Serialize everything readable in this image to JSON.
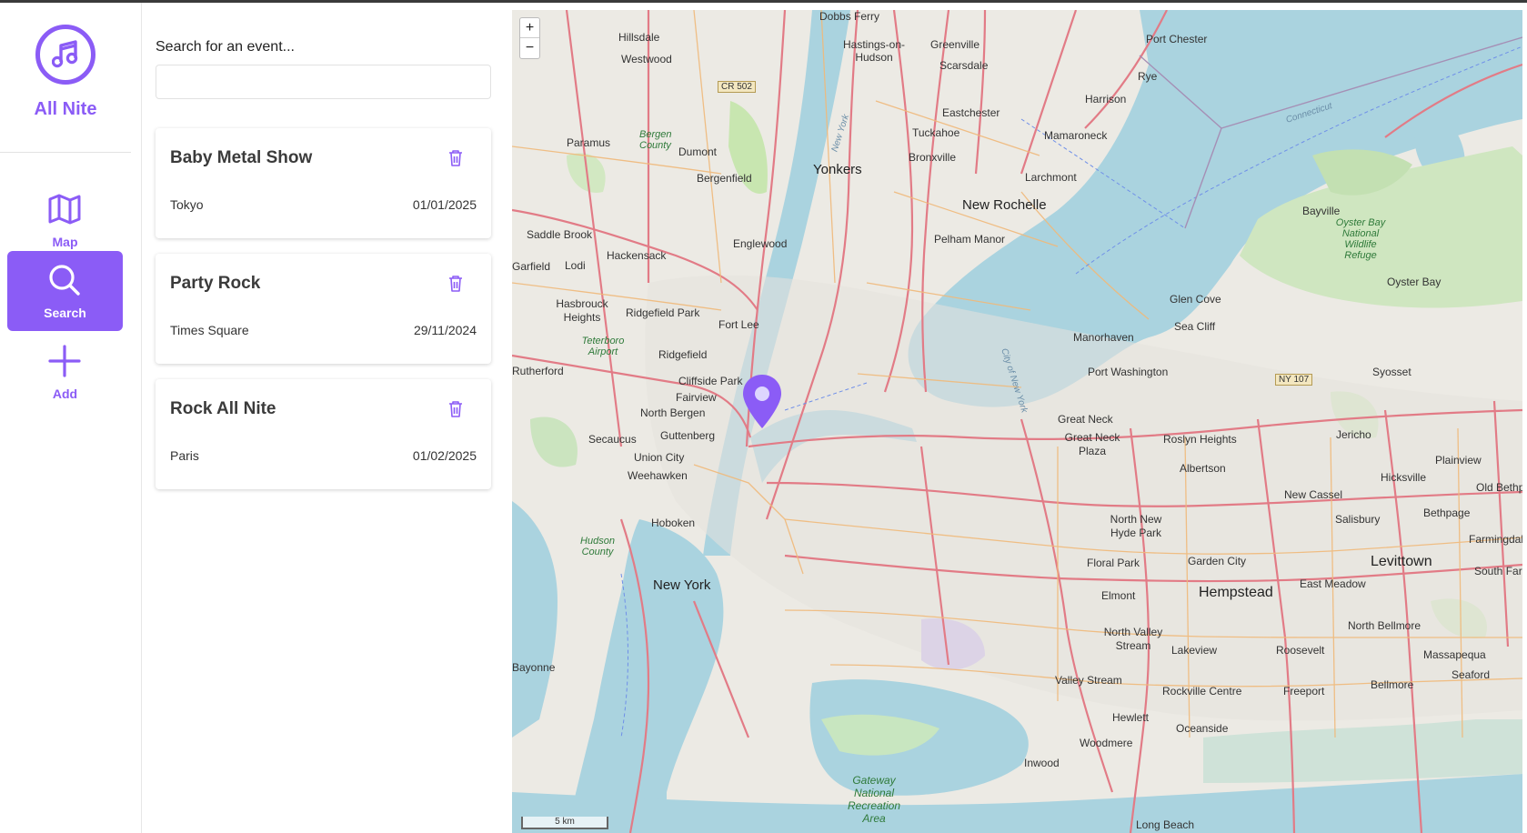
{
  "app": {
    "name": "All Nite",
    "accent": "#8b5cf6"
  },
  "nav": {
    "map_label": "Map",
    "search_label": "Search",
    "add_label": "Add"
  },
  "search": {
    "label": "Search for an event...",
    "placeholder": "",
    "value": ""
  },
  "events": [
    {
      "title": "Baby Metal Show",
      "location": "Tokyo",
      "date": "01/01/2025"
    },
    {
      "title": "Party Rock",
      "location": "Times Square",
      "date": "29/11/2024"
    },
    {
      "title": "Rock All Nite",
      "location": "Paris",
      "date": "01/02/2025"
    }
  ],
  "map": {
    "zoom_in": "+",
    "zoom_out": "−",
    "scale": "5 km",
    "marker_color": "#8b5cf6",
    "places": [
      {
        "name": "Dobbs Ferry",
        "cls": "town"
      },
      {
        "name": "Port Chester",
        "cls": "town"
      },
      {
        "name": "Hillsdale",
        "cls": "town"
      },
      {
        "name": "Westwood",
        "cls": "town"
      },
      {
        "name": "Hastings-on-Hudson",
        "cls": "town"
      },
      {
        "name": "Greenville",
        "cls": "town"
      },
      {
        "name": "Scarsdale",
        "cls": "town"
      },
      {
        "name": "Rye",
        "cls": "town"
      },
      {
        "name": "Harrison",
        "cls": "town"
      },
      {
        "name": "CR 502",
        "cls": "shield"
      },
      {
        "name": "Eastchester",
        "cls": "town"
      },
      {
        "name": "Tuckahoe",
        "cls": "town"
      },
      {
        "name": "Mamaroneck",
        "cls": "town"
      },
      {
        "name": "Paramus",
        "cls": "town"
      },
      {
        "name": "Dumont",
        "cls": "town"
      },
      {
        "name": "Bergen County",
        "cls": "park"
      },
      {
        "name": "Bronxville",
        "cls": "town"
      },
      {
        "name": "Yonkers",
        "cls": "city"
      },
      {
        "name": "Bergenfield",
        "cls": "town"
      },
      {
        "name": "Larchmont",
        "cls": "town"
      },
      {
        "name": "New Rochelle",
        "cls": "city"
      },
      {
        "name": "Bayville",
        "cls": "town"
      },
      {
        "name": "Pelham Manor",
        "cls": "town"
      },
      {
        "name": "Oyster Bay National Wildlife Refuge",
        "cls": "park"
      },
      {
        "name": "Saddle Brook",
        "cls": "town"
      },
      {
        "name": "Englewood",
        "cls": "town"
      },
      {
        "name": "Hackensack",
        "cls": "town"
      },
      {
        "name": "Oyster Bay",
        "cls": "town"
      },
      {
        "name": "Garfield",
        "cls": "town"
      },
      {
        "name": "Lodi",
        "cls": "town"
      },
      {
        "name": "Glen Cove",
        "cls": "town"
      },
      {
        "name": "Hasbrouck Heights",
        "cls": "town"
      },
      {
        "name": "Ridgefield Park",
        "cls": "town"
      },
      {
        "name": "Fort Lee",
        "cls": "town"
      },
      {
        "name": "Sea Cliff",
        "cls": "town"
      },
      {
        "name": "Teterboro Airport",
        "cls": "park"
      },
      {
        "name": "Ridgefield",
        "cls": "town"
      },
      {
        "name": "Manorhaven",
        "cls": "town"
      },
      {
        "name": "Rutherford",
        "cls": "town"
      },
      {
        "name": "Cliffside Park",
        "cls": "town"
      },
      {
        "name": "Port Washington",
        "cls": "town"
      },
      {
        "name": "NY 107",
        "cls": "shield"
      },
      {
        "name": "Syosset",
        "cls": "town"
      },
      {
        "name": "Fairview",
        "cls": "town"
      },
      {
        "name": "North Bergen",
        "cls": "town"
      },
      {
        "name": "Great Neck",
        "cls": "town"
      },
      {
        "name": "Great Neck Plaza",
        "cls": "town"
      },
      {
        "name": "Secaucus",
        "cls": "town"
      },
      {
        "name": "Guttenberg",
        "cls": "town"
      },
      {
        "name": "Roslyn Heights",
        "cls": "town"
      },
      {
        "name": "Jericho",
        "cls": "town"
      },
      {
        "name": "Union City",
        "cls": "town"
      },
      {
        "name": "Albertson",
        "cls": "town"
      },
      {
        "name": "Plainview",
        "cls": "town"
      },
      {
        "name": "Weehawken",
        "cls": "town"
      },
      {
        "name": "Hicksville",
        "cls": "town"
      },
      {
        "name": "Old Bethpage",
        "cls": "town"
      },
      {
        "name": "New Cassel",
        "cls": "town"
      },
      {
        "name": "Hoboken",
        "cls": "town"
      },
      {
        "name": "North New Hyde Park",
        "cls": "town"
      },
      {
        "name": "Bethpage",
        "cls": "town"
      },
      {
        "name": "Salisbury",
        "cls": "town"
      },
      {
        "name": "Hudson County",
        "cls": "park"
      },
      {
        "name": "Farmingdale",
        "cls": "town"
      },
      {
        "name": "Floral Park",
        "cls": "town"
      },
      {
        "name": "Garden City",
        "cls": "town"
      },
      {
        "name": "Levittown",
        "cls": "city"
      },
      {
        "name": "South Farming",
        "cls": "town"
      },
      {
        "name": "New York",
        "cls": "city"
      },
      {
        "name": "East Meadow",
        "cls": "town"
      },
      {
        "name": "Elmont",
        "cls": "town"
      },
      {
        "name": "Hempstead",
        "cls": "city"
      },
      {
        "name": "North Bellmore",
        "cls": "town"
      },
      {
        "name": "North Valley Stream",
        "cls": "town"
      },
      {
        "name": "Lakeview",
        "cls": "town"
      },
      {
        "name": "Roosevelt",
        "cls": "town"
      },
      {
        "name": "Massapequa",
        "cls": "town"
      },
      {
        "name": "Bayonne",
        "cls": "town"
      },
      {
        "name": "Seaford",
        "cls": "town"
      },
      {
        "name": "Valley Stream",
        "cls": "town"
      },
      {
        "name": "Bellmore",
        "cls": "town"
      },
      {
        "name": "Rockville Centre",
        "cls": "town"
      },
      {
        "name": "Freeport",
        "cls": "town"
      },
      {
        "name": "Hewlett",
        "cls": "town"
      },
      {
        "name": "Oceanside",
        "cls": "town"
      },
      {
        "name": "Woodmere",
        "cls": "town"
      },
      {
        "name": "Inwood",
        "cls": "town"
      },
      {
        "name": "Gateway National Recreation Area",
        "cls": "park"
      },
      {
        "name": "Long Beach",
        "cls": "town"
      },
      {
        "name": "Connecticut",
        "cls": "water"
      },
      {
        "name": "City of New York",
        "cls": "water"
      },
      {
        "name": "New York",
        "cls": "water"
      }
    ]
  }
}
